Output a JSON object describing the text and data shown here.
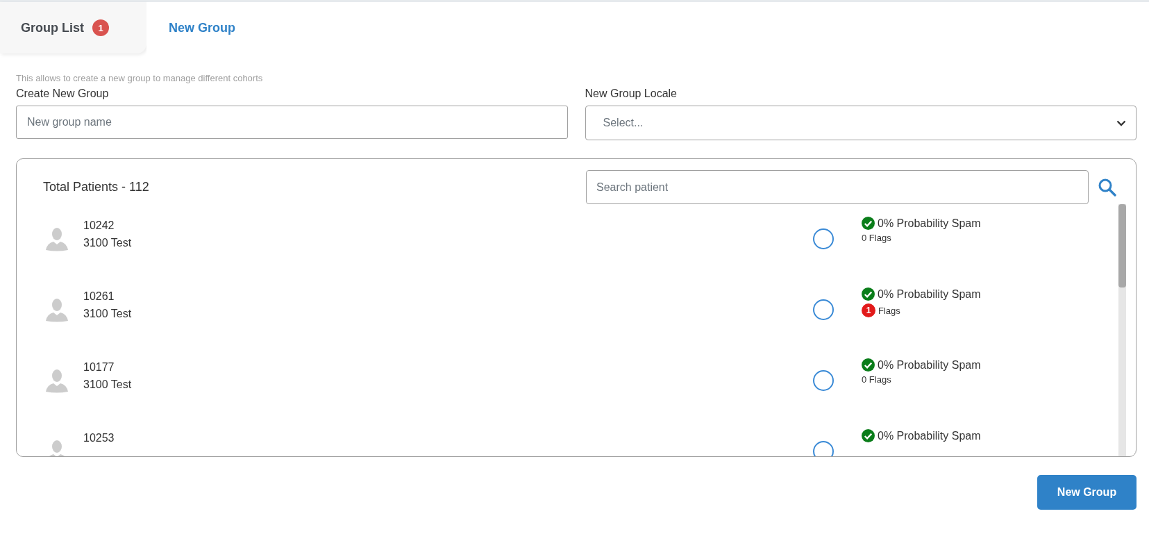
{
  "tabs": [
    {
      "label": "Group List",
      "badge": "1",
      "selected": false
    },
    {
      "label": "New Group",
      "selected": true
    }
  ],
  "form": {
    "hint": "This allows to create a new group to manage different cohorts",
    "name_field": {
      "label": "Create New Group",
      "placeholder": "New group name"
    },
    "locale_field": {
      "label": "New Group Locale",
      "placeholder": "Select..."
    }
  },
  "patients": {
    "total": "Total Patients - 112",
    "search": {
      "placeholder": "Search patient"
    },
    "rows": [
      {
        "id": "10242",
        "name": "3100 Test",
        "selected": false,
        "spam": "0% Probability Spam",
        "flags": {
          "count": "0",
          "label": "Flags",
          "alert": false
        }
      },
      {
        "id": "10261",
        "name": "3100 Test",
        "selected": false,
        "spam": "0% Probability Spam",
        "flags": {
          "count": "1",
          "label": "Flags",
          "alert": true
        }
      },
      {
        "id": "10177",
        "name": "3100 Test",
        "selected": false,
        "spam": "0% Probability Spam",
        "flags": {
          "count": "0",
          "label": "Flags",
          "alert": false
        }
      },
      {
        "id": "10253",
        "selected": false,
        "spam": "0% Probability Spam"
      }
    ]
  },
  "buttons": [
    {
      "label": "New Group"
    }
  ]
}
